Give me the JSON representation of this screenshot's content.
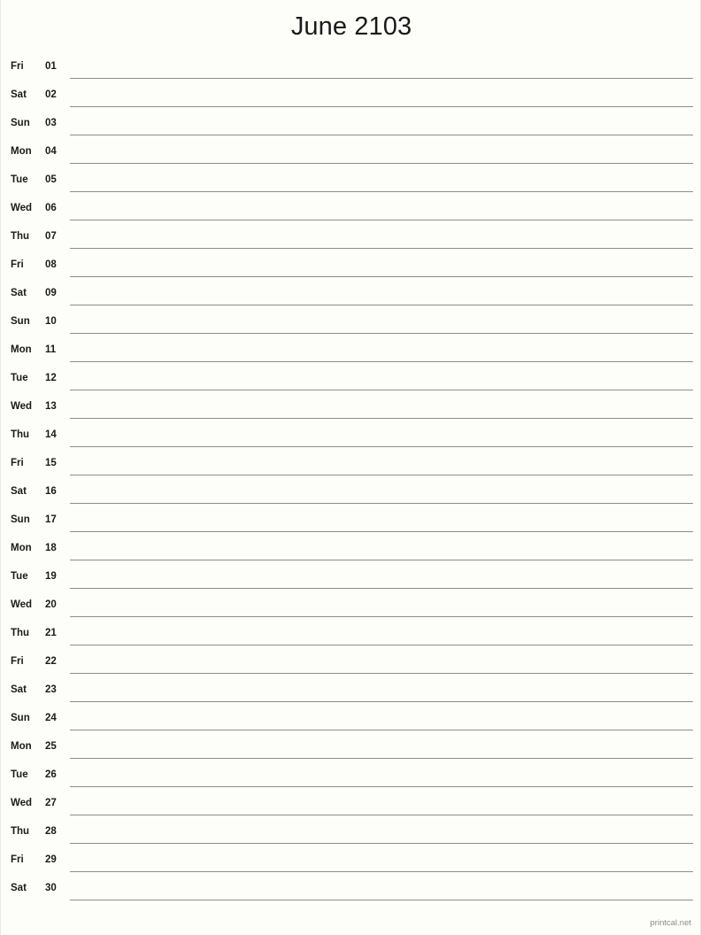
{
  "document": {
    "title": "June 2103",
    "month": "June",
    "year": "2103",
    "footer": "printcal.net",
    "line_color": "#8a8f88",
    "background_color": "#fdfdfa",
    "text_color": "#1a1a1a",
    "footer_color": "#8a8a8a"
  },
  "rows": [
    {
      "weekday": "Fri",
      "day": "01"
    },
    {
      "weekday": "Sat",
      "day": "02"
    },
    {
      "weekday": "Sun",
      "day": "03"
    },
    {
      "weekday": "Mon",
      "day": "04"
    },
    {
      "weekday": "Tue",
      "day": "05"
    },
    {
      "weekday": "Wed",
      "day": "06"
    },
    {
      "weekday": "Thu",
      "day": "07"
    },
    {
      "weekday": "Fri",
      "day": "08"
    },
    {
      "weekday": "Sat",
      "day": "09"
    },
    {
      "weekday": "Sun",
      "day": "10"
    },
    {
      "weekday": "Mon",
      "day": "11"
    },
    {
      "weekday": "Tue",
      "day": "12"
    },
    {
      "weekday": "Wed",
      "day": "13"
    },
    {
      "weekday": "Thu",
      "day": "14"
    },
    {
      "weekday": "Fri",
      "day": "15"
    },
    {
      "weekday": "Sat",
      "day": "16"
    },
    {
      "weekday": "Sun",
      "day": "17"
    },
    {
      "weekday": "Mon",
      "day": "18"
    },
    {
      "weekday": "Tue",
      "day": "19"
    },
    {
      "weekday": "Wed",
      "day": "20"
    },
    {
      "weekday": "Thu",
      "day": "21"
    },
    {
      "weekday": "Fri",
      "day": "22"
    },
    {
      "weekday": "Sat",
      "day": "23"
    },
    {
      "weekday": "Sun",
      "day": "24"
    },
    {
      "weekday": "Mon",
      "day": "25"
    },
    {
      "weekday": "Tue",
      "day": "26"
    },
    {
      "weekday": "Wed",
      "day": "27"
    },
    {
      "weekday": "Thu",
      "day": "28"
    },
    {
      "weekday": "Fri",
      "day": "29"
    },
    {
      "weekday": "Sat",
      "day": "30"
    }
  ]
}
